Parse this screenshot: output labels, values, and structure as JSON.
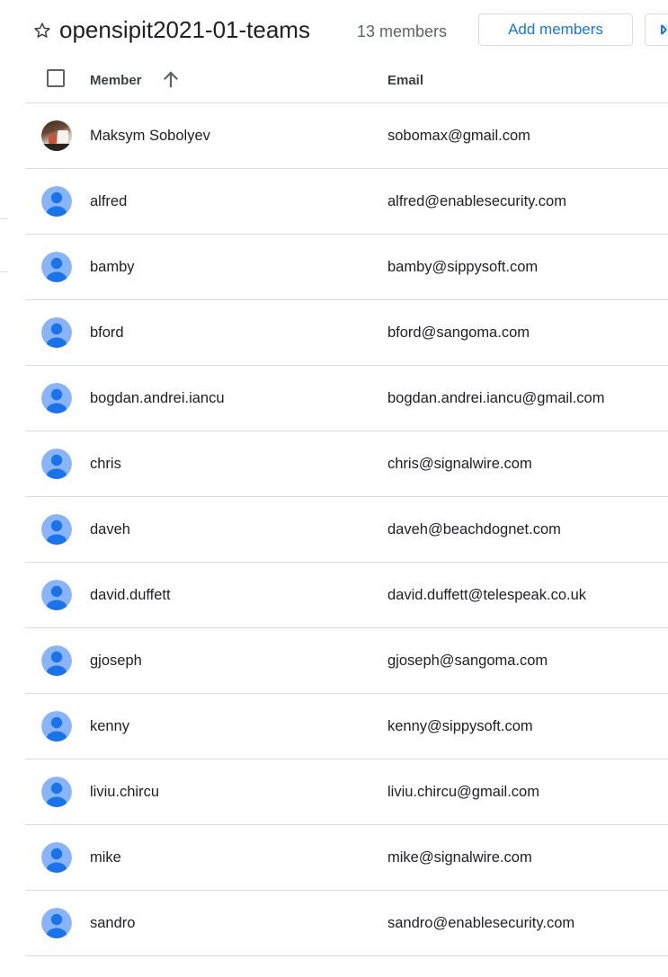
{
  "header": {
    "star_icon": "star-outline-icon",
    "group_title": "opensipit2021-01-teams",
    "member_count": "13 members",
    "add_members_label": "Add members",
    "accent_color": "#1a73e8"
  },
  "table": {
    "columns": {
      "member": "Member",
      "email": "Email"
    },
    "sort_icon": "arrow-upward-icon",
    "rows": [
      {
        "name": "Maksym Sobolyev",
        "email": "sobomax@gmail.com",
        "avatar": "photo"
      },
      {
        "name": "alfred",
        "email": "alfred@enablesecurity.com",
        "avatar": "default-person-icon"
      },
      {
        "name": "bamby",
        "email": "bamby@sippysoft.com",
        "avatar": "default-person-icon"
      },
      {
        "name": "bford",
        "email": "bford@sangoma.com",
        "avatar": "default-person-icon"
      },
      {
        "name": "bogdan.andrei.iancu",
        "email": "bogdan.andrei.iancu@gmail.com",
        "avatar": "default-person-icon"
      },
      {
        "name": "chris",
        "email": "chris@signalwire.com",
        "avatar": "default-person-icon"
      },
      {
        "name": "daveh",
        "email": "daveh@beachdognet.com",
        "avatar": "default-person-icon"
      },
      {
        "name": "david.duffett",
        "email": "david.duffett@telespeak.co.uk",
        "avatar": "default-person-icon"
      },
      {
        "name": "gjoseph",
        "email": "gjoseph@sangoma.com",
        "avatar": "default-person-icon"
      },
      {
        "name": "kenny",
        "email": "kenny@sippysoft.com",
        "avatar": "default-person-icon"
      },
      {
        "name": "liviu.chircu",
        "email": "liviu.chircu@gmail.com",
        "avatar": "default-person-icon"
      },
      {
        "name": "mike",
        "email": "mike@signalwire.com",
        "avatar": "default-person-icon"
      },
      {
        "name": "sandro",
        "email": "sandro@enablesecurity.com",
        "avatar": "default-person-icon"
      }
    ]
  }
}
